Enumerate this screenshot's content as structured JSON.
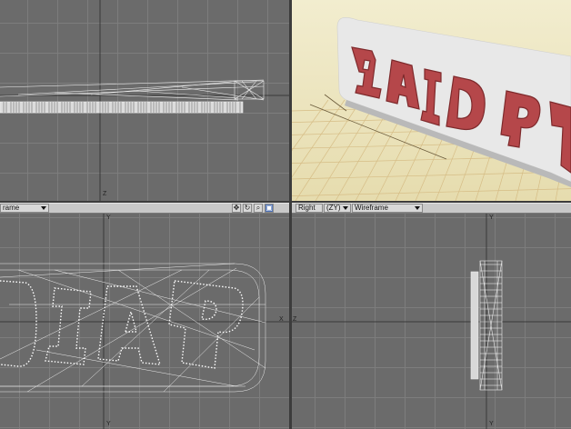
{
  "viewports": {
    "top_left": {
      "axis_label": "Z"
    },
    "bottom_left": {
      "view_mode": "rame",
      "axis_label_top": "Y",
      "axis_label_bottom": "Y",
      "axis_label_right": "X"
    },
    "bottom_right": {
      "view_name": "Right",
      "view_axes": "(ZY)",
      "view_mode": "Wireframe",
      "axis_label_top": "Y",
      "axis_label_bottom": "Y",
      "axis_label_left": "Z"
    },
    "perspective": {
      "sign_text": "PAID"
    }
  },
  "toolbar_icons": [
    "move-view-icon",
    "rotate-view-icon",
    "zoom-view-icon",
    "maximize-view-icon"
  ],
  "colors": {
    "grid_bg": "#6b6b6b",
    "perspective_bg": "#eae3b8",
    "floor_grid": "#d9bf8a",
    "sign_face": "#e8e8e8",
    "letter_red": "#b5474a",
    "letter_red_dark": "#8a2e30"
  }
}
